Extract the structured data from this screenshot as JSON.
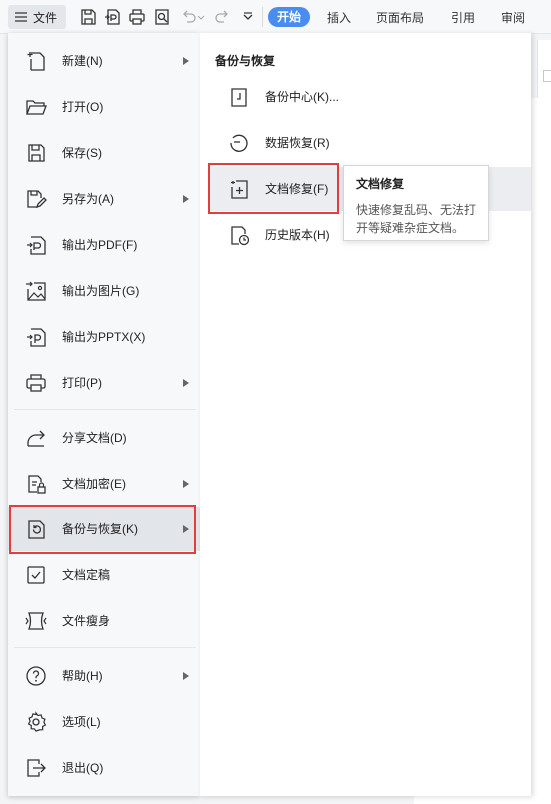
{
  "toolbar": {
    "file_label": "文件",
    "tabs": [
      "开始",
      "插入",
      "页面布局",
      "引用",
      "审阅"
    ],
    "icons": [
      "menu-icon",
      "save-icon",
      "export-pdf-icon",
      "print-icon",
      "print-preview-icon",
      "undo-icon",
      "redo-icon",
      "more-icon"
    ],
    "accent": "#4a8df0"
  },
  "menu": {
    "items": [
      {
        "label": "新建(N)",
        "icon": "new-file-icon",
        "submenu": true
      },
      {
        "label": "打开(O)",
        "icon": "folder-icon",
        "submenu": false
      },
      {
        "label": "保存(S)",
        "icon": "save-icon",
        "submenu": false
      },
      {
        "label": "另存为(A)",
        "icon": "save-as-icon",
        "submenu": true
      },
      {
        "label": "输出为PDF(F)",
        "icon": "pdf-icon",
        "submenu": false
      },
      {
        "label": "输出为图片(G)",
        "icon": "image-icon",
        "submenu": false
      },
      {
        "label": "输出为PPTX(X)",
        "icon": "pptx-icon",
        "submenu": false
      },
      {
        "label": "打印(P)",
        "icon": "print-icon",
        "submenu": true
      },
      {
        "label": "分享文档(D)",
        "icon": "share-icon",
        "submenu": false
      },
      {
        "label": "文档加密(E)",
        "icon": "encrypt-icon",
        "submenu": true
      },
      {
        "label": "备份与恢复(K)",
        "icon": "backup-icon",
        "submenu": true,
        "selected": true
      },
      {
        "label": "文档定稿",
        "icon": "finalize-icon",
        "submenu": false
      },
      {
        "label": "文件瘦身",
        "icon": "slim-icon",
        "submenu": false
      },
      {
        "label": "帮助(H)",
        "icon": "help-icon",
        "submenu": true
      },
      {
        "label": "选项(L)",
        "icon": "options-gear-icon",
        "submenu": false
      },
      {
        "label": "退出(Q)",
        "icon": "exit-icon",
        "submenu": false
      }
    ]
  },
  "submenu": {
    "title": "备份与恢复",
    "items": [
      {
        "label": "备份中心(K)...",
        "icon": "backup-center-icon"
      },
      {
        "label": "数据恢复(R)",
        "icon": "data-recovery-icon"
      },
      {
        "label": "文档修复(F)",
        "icon": "document-repair-icon",
        "hovered": true
      },
      {
        "label": "历史版本(H)",
        "icon": "history-version-icon"
      }
    ]
  },
  "tooltip": {
    "title": "文档修复",
    "desc_line1": "快速修复乱码、无法打",
    "desc_line2": "开等疑难杂症文档。"
  },
  "highlight_color": "#e33e3e"
}
